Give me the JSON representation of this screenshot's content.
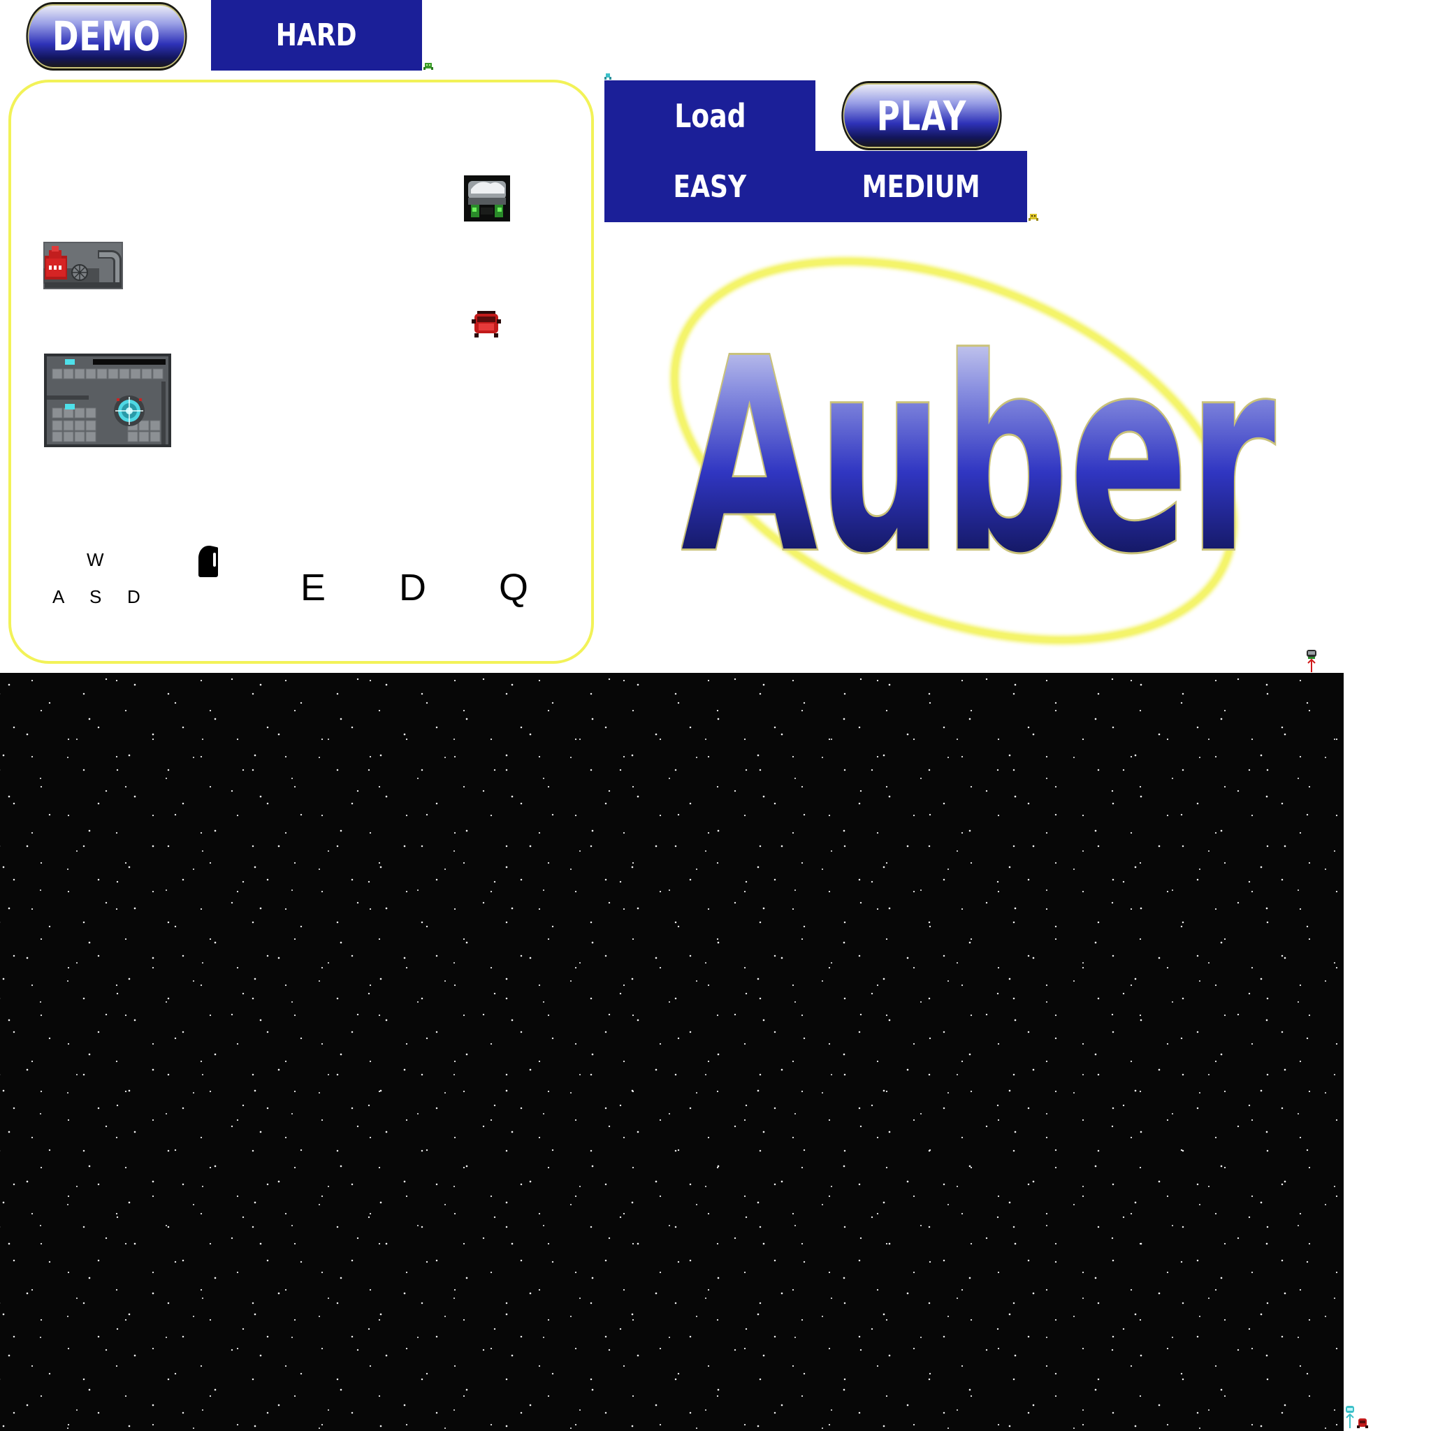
{
  "buttons": {
    "demo": "DEMO",
    "hard": "HARD",
    "load": "Load",
    "play": "PLAY",
    "easy": "EASY",
    "medium": "MEDIUM"
  },
  "title": "Auber",
  "controls": {
    "up": "W",
    "left": "A",
    "down": "S",
    "right": "D",
    "action_e": "E",
    "action_d": "D",
    "action_q": "Q"
  },
  "icons": {
    "mouse": "mouse-icon",
    "hostile_enemy": "red-infiltrator-icon",
    "auber_player": "auber-robot-icon",
    "system": "ship-system-icon",
    "teleport_room": "teleport-room-icon"
  },
  "colors": {
    "button_blue": "#1b1f98",
    "panel_border": "#f2f258",
    "space": "#070707"
  }
}
